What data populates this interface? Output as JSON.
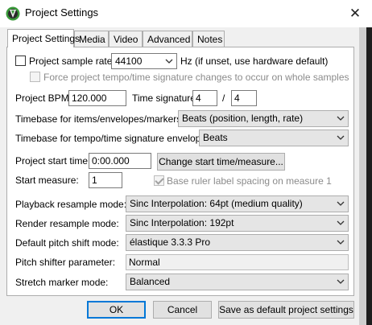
{
  "window": {
    "title": "Project Settings"
  },
  "tabs": [
    "Project Settings",
    "Media",
    "Video",
    "Advanced",
    "Notes"
  ],
  "sample_rate": {
    "label": "Project sample rate:",
    "value": "44100",
    "hint": "Hz (if unset, use hardware default)",
    "checked": false
  },
  "force_tempo": {
    "label": "Force project tempo/time signature changes to occur on whole samples",
    "checked": false
  },
  "bpm": {
    "label": "Project BPM:",
    "value": "120.000"
  },
  "time_signature": {
    "label": "Time signature",
    "numerator": "4",
    "separator": "/",
    "denominator": "4"
  },
  "timebase_items": {
    "label": "Timebase for items/envelopes/markers:",
    "value": "Beats (position, length, rate)"
  },
  "timebase_tempo": {
    "label": "Timebase for tempo/time signature envelope:",
    "value": "Beats"
  },
  "start_time": {
    "label": "Project start time:",
    "value": "0:00.000",
    "button": "Change start time/measure..."
  },
  "start_measure": {
    "label": "Start measure:",
    "value": "1"
  },
  "ruler_spacing": {
    "label": "Base ruler label spacing on measure 1",
    "checked": true
  },
  "playback_resample": {
    "label": "Playback resample mode:",
    "value": "Sinc Interpolation: 64pt (medium quality)"
  },
  "render_resample": {
    "label": "Render resample mode:",
    "value": "Sinc Interpolation: 192pt"
  },
  "pitch_shift": {
    "label": "Default pitch shift mode:",
    "value": "élastique 3.3.3 Pro"
  },
  "pitch_param": {
    "label": "Pitch shifter parameter:",
    "value": "Normal"
  },
  "stretch_marker": {
    "label": "Stretch marker mode:",
    "value": "Balanced"
  },
  "buttons": {
    "ok": "OK",
    "cancel": "Cancel",
    "save_default": "Save as default project settings"
  },
  "icons": {
    "app": "reaper-logo-icon",
    "close": "close-icon",
    "dropdown": "chevron-down-icon"
  },
  "colors": {
    "default_button_border": "#0078d7",
    "logo_green": "#3a9a3a"
  }
}
